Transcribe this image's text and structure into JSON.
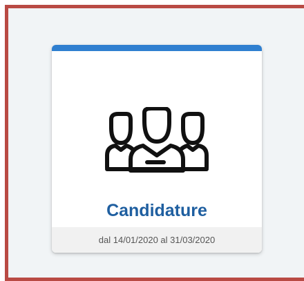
{
  "card": {
    "title": "Candidature",
    "period": "dal 14/01/2020 al 31/03/2020",
    "icon": "candidates-group-icon",
    "accent_color": "#2f7fd0",
    "title_color": "#1f5fa0",
    "frame_color": "#b94a44"
  }
}
